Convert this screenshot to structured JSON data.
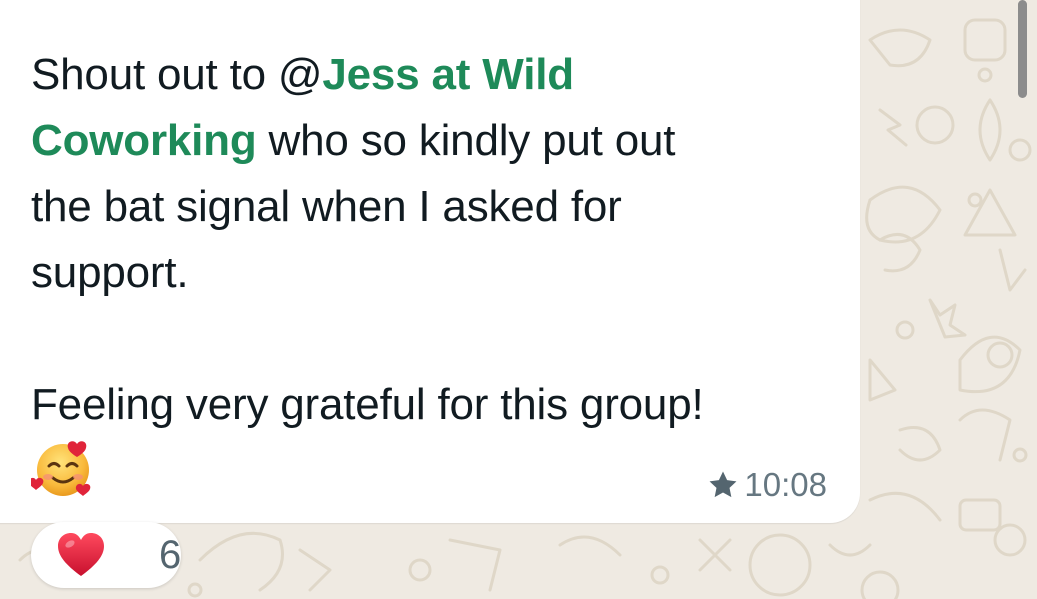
{
  "message": {
    "line1_prefix": "Shout out to ",
    "at_symbol": "@",
    "mention_part1": "Jess at Wild",
    "mention_part2": "Coworking",
    "line2_rest": " who so kindly put out",
    "line3": "the bat signal when I asked for",
    "line4": "support.",
    "line5": "Feeling very grateful for this group!",
    "emoji": "smiling-face-with-hearts",
    "starred": true,
    "time": "10:08"
  },
  "reaction": {
    "emoji": "red-heart",
    "count": "6"
  },
  "colors": {
    "background": "#efeae2",
    "bubble": "#ffffff",
    "mention": "#1e8a59",
    "text": "#111b21",
    "meta": "#667781",
    "heart": "#e0243a"
  }
}
